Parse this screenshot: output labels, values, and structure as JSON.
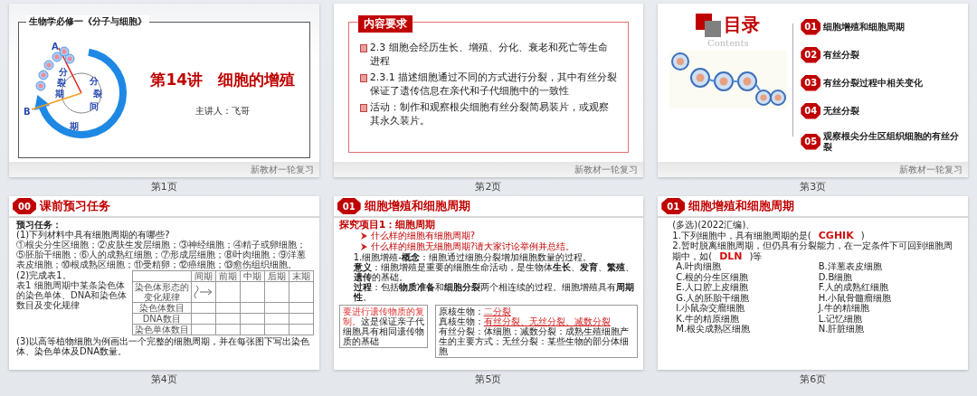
{
  "slides": [
    {
      "kind": "title",
      "label": "第1页",
      "course": "生物学必修一《分子与细胞》",
      "title": "第14讲　细胞的增殖",
      "speaker": "主讲人：飞哥",
      "diagram": {
        "point_a": "A",
        "point_b": "B",
        "phase_outer": "分裂期",
        "phase_inner": "分裂间期"
      },
      "footer": "新教材一轮复习"
    },
    {
      "kind": "requirements",
      "label": "第2页",
      "heading": "内容要求",
      "items": [
        "2.3  细胞会经历生长、增殖、分化、衰老和死亡等生命进程",
        "2.3.1  描述细胞通过不同的方式进行分裂，其中有丝分裂保证了遗传信息在亲代和子代细胞中的一致性",
        "活动：制作和观察根尖细胞有丝分裂简易装片，或观察其永久装片。"
      ],
      "footer": "新教材一轮复习"
    },
    {
      "kind": "contents",
      "label": "第3页",
      "title": "目录",
      "subtitle": "Contents",
      "items": [
        {
          "number": "01",
          "text": "细胞增殖和细胞周期"
        },
        {
          "number": "02",
          "text": "有丝分裂"
        },
        {
          "number": "03",
          "text": "有丝分裂过程中相关变化"
        },
        {
          "number": "04",
          "text": "无丝分裂"
        },
        {
          "number": "05",
          "text": "观察根尖分生区组织细胞的有丝分裂"
        }
      ],
      "footer": "新教材一轮复习"
    },
    {
      "kind": "preview",
      "label": "第4页",
      "badge": "00",
      "title": "课前预习任务",
      "task_heading": "预习任务：",
      "question_1": "(1)下列材料中具有细胞周期的有哪些?",
      "materials": "①根尖分生区细胞；②皮肤生发层细胞；③神经细胞；④精子或卵细胞；⑤胚胎干细胞；⑥人的成熟红细胞；⑦形成层细胞；⑧叶肉细胞；⑨洋葱表皮细胞；⑩根成熟区细胞；⑪受精卵；⑫癌细胞；⑬愈伤组织细胞。",
      "question_2": "(2)完成表1。",
      "table": {
        "caption": "表1 细胞周期中某条染色体的染色单体、DNA和染色体数目及变化规律",
        "columns": [
          "间期",
          "前期",
          "中期",
          "后期",
          "末期"
        ],
        "rows": [
          {
            "label": "染色体形态的变化规律",
            "sketch": true
          },
          {
            "label": "染色体数目",
            "sketch": false
          },
          {
            "label": "DNA数目",
            "sketch": false
          },
          {
            "label": "染色单体数目",
            "sketch": false
          }
        ]
      },
      "question_3": "(3)以高等植物细胞为例画出一个完整的细胞周期，并在每张图下写出染色体、染色单体及DNA数量。"
    },
    {
      "kind": "section",
      "label": "第5页",
      "badge": "01",
      "title": "细胞增殖和细胞周期",
      "project": "探究项目1：细胞周期",
      "questions": [
        "什么样的细胞有细胞周期?",
        "什么样的细胞无细胞周期?请大家讨论举例并总结。"
      ],
      "paragraphs": [
        {
          "label": "1.细胞增殖-**概念**",
          "text": "：细胞通过细胞分裂增加细胞数量的过程。"
        },
        {
          "label": "**意义**",
          "text": "：细胞增殖是重要的细胞生命活动，是生物体**生长**、**发育**、**繁殖**、**遗传**的基础。"
        },
        {
          "label": "**过程**",
          "text": "：包括**物质准备**和**细胞分裂**两个相连续的过程。细胞增殖具有**周期性**。"
        }
      ],
      "note_left": {
        "highlight": "要进行遗传物质的复制。",
        "text": "这是保证亲子代细胞具有相同遗传物质的基础"
      },
      "note_right": {
        "lines": [
          {
            "label": "原核生物：",
            "answer": "二分裂"
          },
          {
            "label": "真核生物：",
            "answer": "有丝分裂、无丝分裂、减数分裂"
          }
        ],
        "text": "有丝分裂：体细胞；减数分裂：成熟生殖细胞产生的主要方式；无丝分裂：某些生物的部分体细胞"
      }
    },
    {
      "kind": "quiz",
      "label": "第6页",
      "badge": "01",
      "title": "细胞增殖和细胞周期",
      "intro": "(多选)(2022汇编)、",
      "questions": [
        {
          "text": "1.下列细胞中，具有细胞周期的是(",
          "answer": "CGHIK",
          "end": ")"
        },
        {
          "text": "2.暂时脱离细胞周期，但仍具有分裂能力，在一定条件下可回到细胞周期中，如(",
          "answer": "DLN",
          "end": ")等"
        }
      ],
      "options": [
        "A.叶肉细胞",
        "B.洋葱表皮细胞",
        "C.根的分生区细胞",
        "D.B细胞",
        "E.人口腔上皮细胞",
        "F.人的成熟红细胞",
        "G.人的胚胎干细胞",
        "H.小鼠骨髓瘤细胞",
        "I.小鼠杂交瘤细胞",
        "J.牛的精细胞",
        "K.牛的精原细胞",
        "L.记忆细胞",
        "M.根尖成熟区细胞",
        "N.肝脏细胞"
      ]
    }
  ]
}
